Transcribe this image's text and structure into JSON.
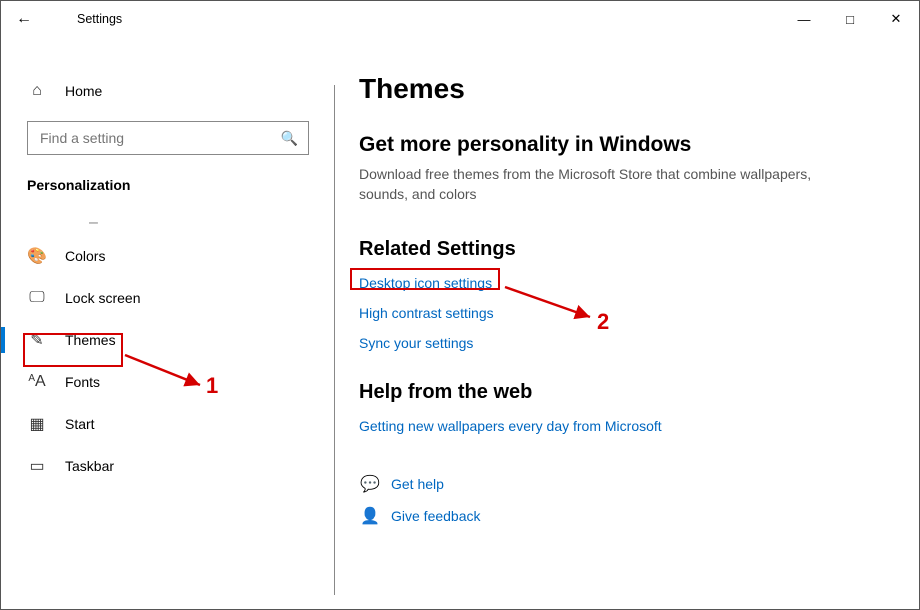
{
  "titlebar": {
    "back": "←",
    "title": "Settings",
    "min": "—",
    "max": "□",
    "close": "✕"
  },
  "sidebar": {
    "home": "Home",
    "search_placeholder": "Find a setting",
    "group": "Personalization",
    "placeholder_dash": "–",
    "items": {
      "colors": "Colors",
      "lock": "Lock screen",
      "themes": "Themes",
      "fonts": "Fonts",
      "start": "Start",
      "taskbar": "Taskbar"
    }
  },
  "main": {
    "page_title": "Themes",
    "sub_title": "Get more personality in Windows",
    "desc": "Download free themes from the Microsoft Store that combine wallpapers, sounds, and colors",
    "related_title": "Related Settings",
    "links": {
      "desktop_icon": "Desktop icon settings",
      "high_contrast": "High contrast settings",
      "sync": "Sync your settings"
    },
    "help_title": "Help from the web",
    "help_link": "Getting new wallpapers every day from Microsoft",
    "get_help": "Get help",
    "feedback": "Give feedback"
  },
  "ann": {
    "l1": "1",
    "l2": "2"
  }
}
